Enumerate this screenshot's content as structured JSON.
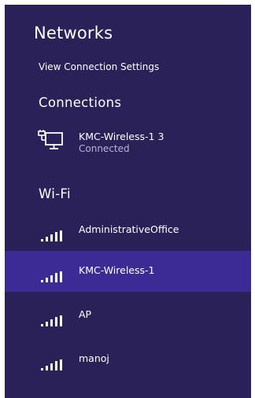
{
  "panel": {
    "title": "Networks",
    "settings_link": "View Connection Settings",
    "background_color": "#2a2159",
    "selected_color": "#3c2b94"
  },
  "connections": {
    "heading": "Connections",
    "items": [
      {
        "name": "KMC-Wireless-1  3",
        "status": "Connected",
        "icon": "wired-network-icon"
      }
    ]
  },
  "wifi": {
    "heading": "Wi-Fi",
    "networks": [
      {
        "name": "AdministrativeOffice",
        "icon": "wifi-signal-icon",
        "selected": false
      },
      {
        "name": "KMC-Wireless-1",
        "icon": "wifi-signal-icon",
        "selected": true
      },
      {
        "name": "AP",
        "icon": "wifi-signal-icon",
        "selected": false
      },
      {
        "name": "manoj",
        "icon": "wifi-signal-icon",
        "selected": false
      }
    ]
  }
}
